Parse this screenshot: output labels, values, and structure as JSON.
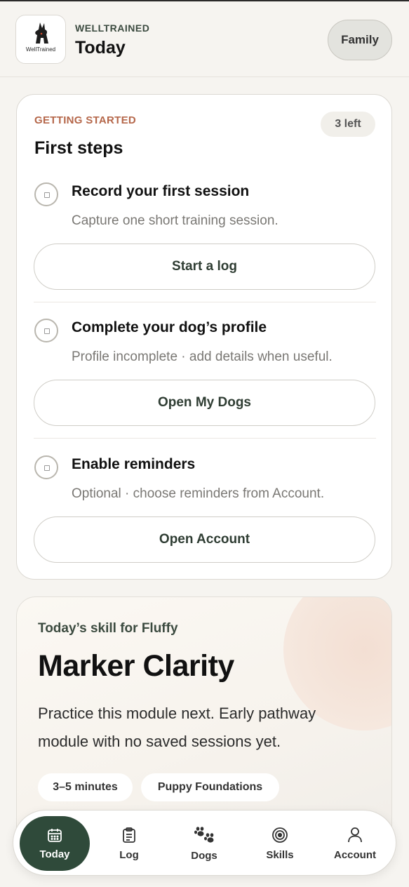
{
  "header": {
    "logo_text": "WellTrained",
    "brand": "WELLTRAINED",
    "title": "Today",
    "family_button": "Family"
  },
  "first_steps": {
    "eyebrow": "GETTING STARTED",
    "title": "First steps",
    "remaining_badge": "3 left",
    "steps": [
      {
        "title": "Record your first session",
        "description": "Capture one short training session.",
        "button": "Start a log",
        "completed": false
      },
      {
        "title": "Complete your dog’s profile",
        "description": "Profile incomplete · add details when useful.",
        "button": "Open My Dogs",
        "completed": false
      },
      {
        "title": "Enable reminders",
        "description": "Optional · choose reminders from Account.",
        "button": "Open Account",
        "completed": false
      }
    ]
  },
  "skill": {
    "kicker": "Today’s skill for Fluffy",
    "title": "Marker Clarity",
    "description": "Practice this module next. Early pathway module with no saved sessions yet.",
    "chips": [
      "3–5 minutes",
      "Puppy Foundations"
    ]
  },
  "nav": {
    "items": [
      {
        "label": "Today",
        "icon": "calendar-icon",
        "active": true
      },
      {
        "label": "Log",
        "icon": "clipboard-icon",
        "active": false
      },
      {
        "label": "Dogs",
        "icon": "paw-icon",
        "active": false
      },
      {
        "label": "Skills",
        "icon": "target-icon",
        "active": false
      },
      {
        "label": "Account",
        "icon": "user-icon",
        "active": false
      }
    ]
  },
  "colors": {
    "accent_green": "#2f4a3a",
    "eyebrow_orange": "#b5674a",
    "background": "#f6f4f0"
  }
}
